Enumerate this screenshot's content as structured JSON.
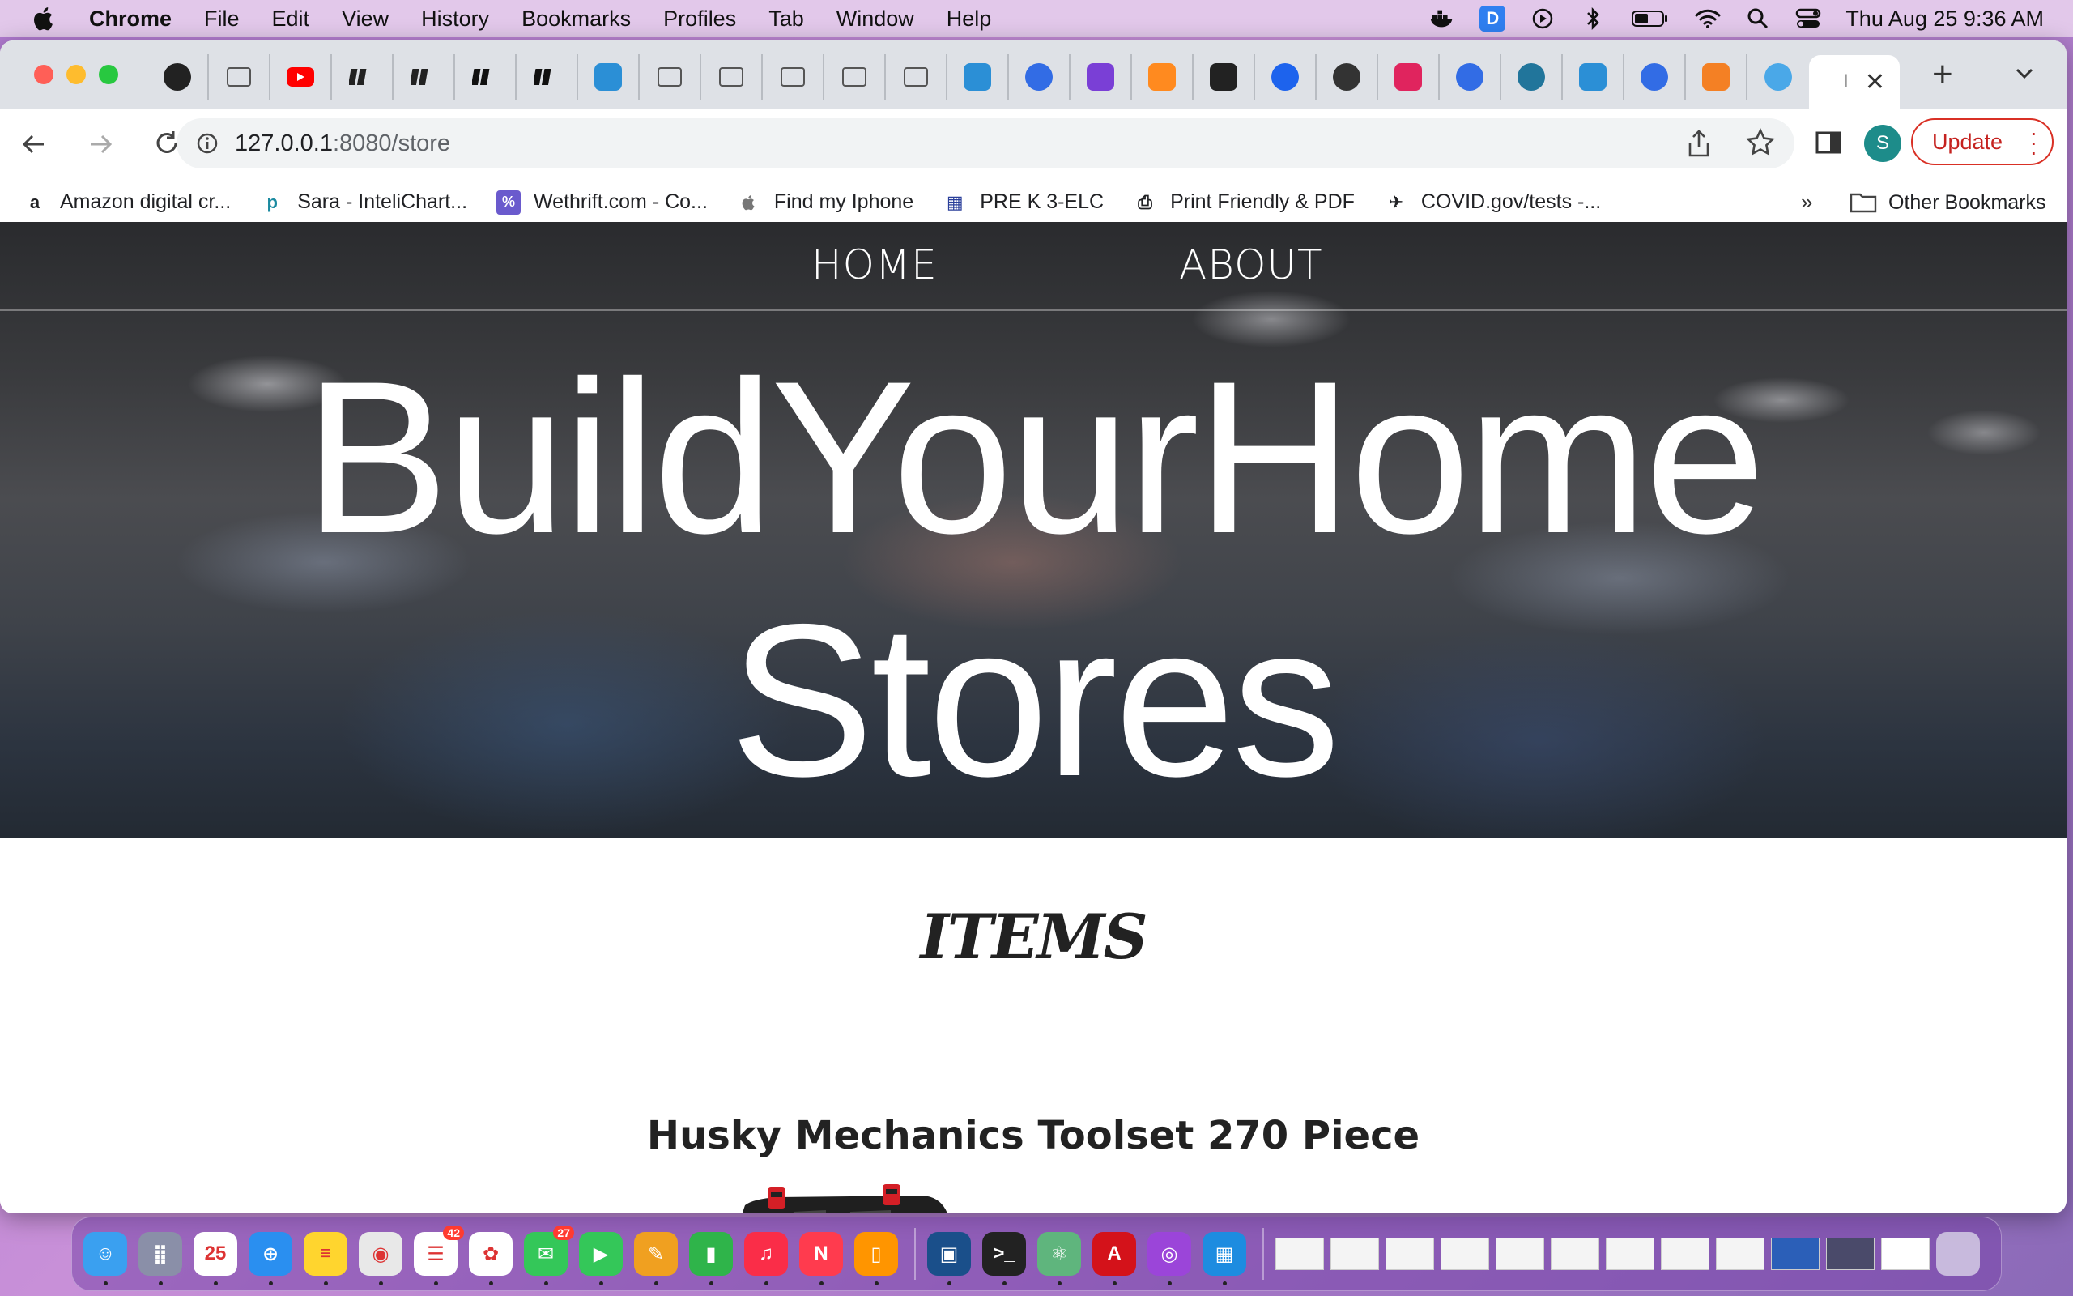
{
  "menubar": {
    "app": "Chrome",
    "items": [
      "File",
      "Edit",
      "View",
      "History",
      "Bookmarks",
      "Profiles",
      "Tab",
      "Window",
      "Help"
    ],
    "clock": "Thu Aug 25  9:36 AM"
  },
  "tabs": [
    {
      "icon": "github-icon",
      "color": "#222"
    },
    {
      "icon": "article-icon",
      "color": "#555"
    },
    {
      "icon": "youtube-icon",
      "color": "#ff0000"
    },
    {
      "icon": "books-icon",
      "color": "#222"
    },
    {
      "icon": "books-icon",
      "color": "#222"
    },
    {
      "icon": "books-icon",
      "color": "#111"
    },
    {
      "icon": "books-icon",
      "color": "#111"
    },
    {
      "icon": "fox-icon",
      "color": "#2b8fd6"
    },
    {
      "icon": "article-icon",
      "color": "#555"
    },
    {
      "icon": "article-icon",
      "color": "#555"
    },
    {
      "icon": "article-icon",
      "color": "#555"
    },
    {
      "icon": "article-icon",
      "color": "#555"
    },
    {
      "icon": "article-icon",
      "color": "#555"
    },
    {
      "icon": "fox-icon",
      "color": "#2b8fd6"
    },
    {
      "icon": "kubernetes-icon",
      "color": "#326ce5"
    },
    {
      "icon": "u-icon",
      "color": "#7a3fd6"
    },
    {
      "icon": "box-icon",
      "color": "#ff8a1f"
    },
    {
      "icon": "edx-icon",
      "color": "#222"
    },
    {
      "icon": "docker-icon",
      "color": "#1d63ed"
    },
    {
      "icon": "docker-icon",
      "color": "#333"
    },
    {
      "icon": "play-icon",
      "color": "#e0245e"
    },
    {
      "icon": "kubernetes-icon",
      "color": "#326ce5"
    },
    {
      "icon": "wordpress-icon",
      "color": "#21759b"
    },
    {
      "icon": "fox-icon",
      "color": "#2b8fd6"
    },
    {
      "icon": "kubernetes-icon",
      "color": "#326ce5"
    },
    {
      "icon": "stackoverflow-icon",
      "color": "#f48024"
    },
    {
      "icon": "globe-icon",
      "color": "#4aa8e8"
    }
  ],
  "active_tab": {
    "label": "I",
    "close": "✕"
  },
  "omnibox": {
    "host": "127.0.0.1",
    "rest": ":8080/store"
  },
  "profile_initial": "S",
  "update_label": "Update",
  "bookmarks": [
    {
      "label": "Amazon digital cr...",
      "icon": "amazon-icon",
      "glyph": "a"
    },
    {
      "label": "Sara - InteliChart...",
      "icon": "intelichart-icon",
      "glyph": "p"
    },
    {
      "label": "Wethrift.com - Co...",
      "icon": "percent-icon",
      "glyph": "%"
    },
    {
      "label": "Find my Iphone",
      "icon": "apple-icon",
      "glyph": ""
    },
    {
      "label": "PRE K 3-ELC",
      "icon": "grid-icon",
      "glyph": "▦"
    },
    {
      "label": "Print Friendly & PDF",
      "icon": "printer-icon",
      "glyph": "⎙"
    },
    {
      "label": "COVID.gov/tests -...",
      "icon": "eagle-icon",
      "glyph": "✈"
    }
  ],
  "bookmarks_more": "»",
  "other_bookmarks": "Other Bookmarks",
  "site": {
    "nav": {
      "home": "HOME",
      "about": "ABOUT"
    },
    "title_line1": "BuildYourHome",
    "title_line2": "Stores",
    "section_heading": "ITEMS",
    "product_title": "Husky Mechanics Toolset 270 Piece"
  },
  "dock": {
    "apps": [
      {
        "name": "finder-icon",
        "color": "#3aa0f0",
        "glyph": "☺"
      },
      {
        "name": "launchpad-icon",
        "color": "#8a8fa8",
        "glyph": "⣿"
      },
      {
        "name": "calendar-icon",
        "color": "#ffffff",
        "glyph": "25"
      },
      {
        "name": "safari-icon",
        "color": "#2a8ff0",
        "glyph": "⊕"
      },
      {
        "name": "notes-icon",
        "color": "#ffd52e",
        "glyph": "≡"
      },
      {
        "name": "chrome-icon",
        "color": "#e8e8e8",
        "glyph": "◉"
      },
      {
        "name": "reminders-icon",
        "color": "#ffffff",
        "glyph": "☰",
        "badge": "42"
      },
      {
        "name": "photos-icon",
        "color": "#ffffff",
        "glyph": "✿"
      },
      {
        "name": "messages-icon",
        "color": "#34c759",
        "glyph": "✉",
        "badge": "27"
      },
      {
        "name": "facetime-icon",
        "color": "#34c759",
        "glyph": "▶"
      },
      {
        "name": "pages-icon",
        "color": "#f0a020",
        "glyph": "✎"
      },
      {
        "name": "numbers-icon",
        "color": "#2fb44a",
        "glyph": "▮"
      },
      {
        "name": "music-icon",
        "color": "#fa2d48",
        "glyph": "♫"
      },
      {
        "name": "news-icon",
        "color": "#ff3b4e",
        "glyph": "N"
      },
      {
        "name": "books-app-icon",
        "color": "#ff9500",
        "glyph": "▯"
      },
      {
        "name": "virtualbox-icon",
        "color": "#1a4f8a",
        "glyph": "▣"
      },
      {
        "name": "terminal-icon",
        "color": "#222222",
        "glyph": ">_"
      },
      {
        "name": "atom-icon",
        "color": "#5fb57d",
        "glyph": "⚛"
      },
      {
        "name": "acrobat-icon",
        "color": "#d4121a",
        "glyph": "A"
      },
      {
        "name": "podcasts-icon",
        "color": "#9b45d9",
        "glyph": "◎"
      },
      {
        "name": "docker-app-icon",
        "color": "#1d8ce0",
        "glyph": "▦"
      }
    ],
    "thumb_count": 12
  }
}
